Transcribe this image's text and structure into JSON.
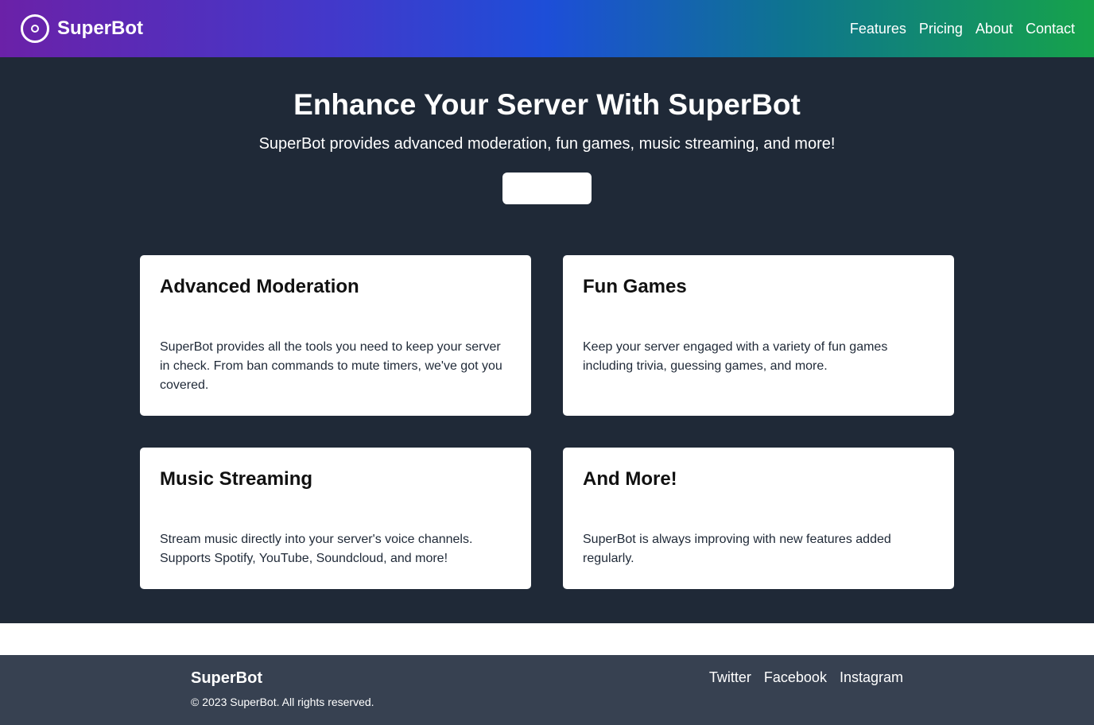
{
  "nav": {
    "brand": "SuperBot",
    "links": [
      "Features",
      "Pricing",
      "About",
      "Contact"
    ]
  },
  "hero": {
    "title": "Enhance Your Server With SuperBot",
    "subtitle": "SuperBot provides advanced moderation, fun games, music streaming, and more!",
    "button_label": ""
  },
  "features": [
    {
      "title": "Advanced Moderation",
      "text": "SuperBot provides all the tools you need to keep your server in check. From ban commands to mute timers, we've got you covered."
    },
    {
      "title": "Fun Games",
      "text": "Keep your server engaged with a variety of fun games including trivia, guessing games, and more."
    },
    {
      "title": "Music Streaming",
      "text": "Stream music directly into your server's voice channels. Supports Spotify, YouTube, Soundcloud, and more!"
    },
    {
      "title": "And More!",
      "text": "SuperBot is always improving with new features added regularly."
    }
  ],
  "footer": {
    "brand": "SuperBot",
    "copyright": "© 2023 SuperBot. All rights reserved.",
    "links": [
      "Twitter",
      "Facebook",
      "Instagram"
    ]
  },
  "colors": {
    "gradient": [
      "#6b21a8",
      "#1d4ed8",
      "#16a34a"
    ],
    "main_bg": "#1f2937",
    "footer_bg": "#374151"
  }
}
